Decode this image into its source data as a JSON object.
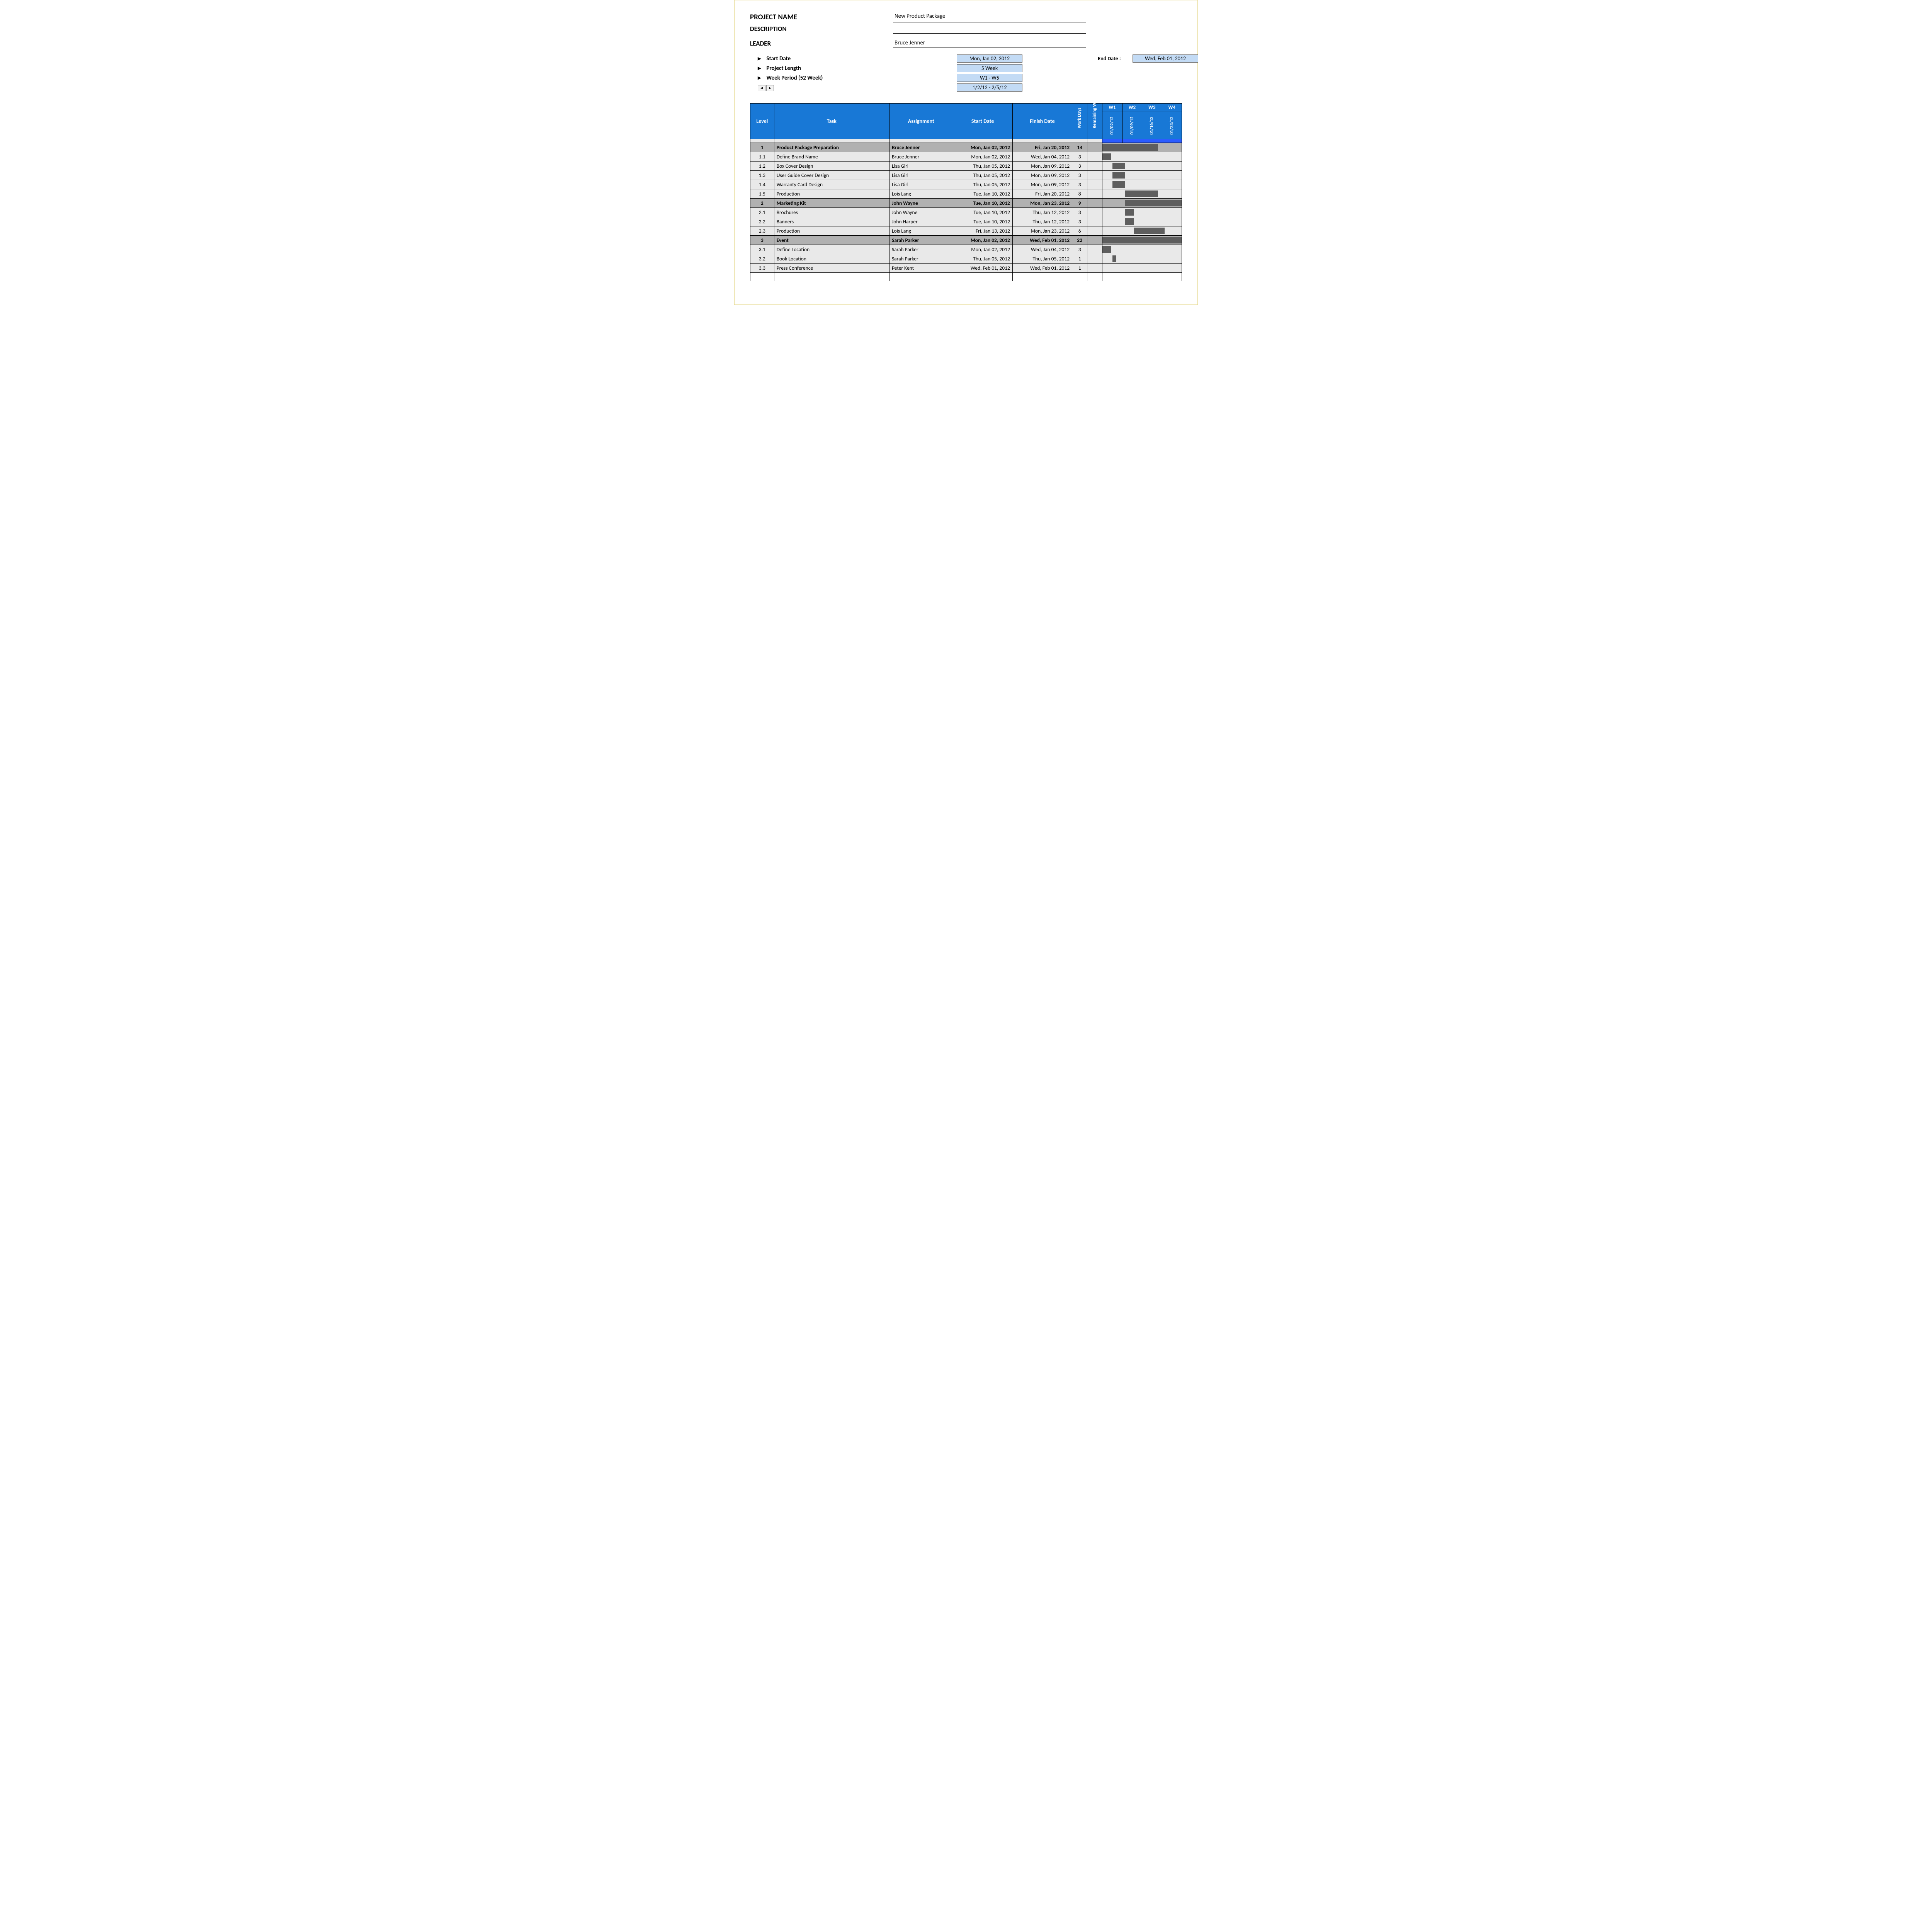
{
  "labels": {
    "projectName": "PROJECT NAME",
    "description": "DESCRIPTION",
    "leader": "LEADER",
    "startDate": "Start Date",
    "projectLength": "Project Length",
    "weekPeriod": "Week Period (52 Week)",
    "endDate": "End Date :"
  },
  "header": {
    "projectName": "New Product Package",
    "description": "",
    "leader": "Bruce Jenner",
    "startDate": "Mon, Jan 02, 2012",
    "endDate": "Wed, Feb 01, 2012",
    "projectLength": "5 Week",
    "weekPeriod": "W1 - W5",
    "dateRange": "1/2/12 - 2/5/12"
  },
  "columns": {
    "level": "Level",
    "task": "Task",
    "assignment": "Assignment",
    "startDate": "Start Date",
    "finishDate": "Finish Date",
    "workDays": "Work Days",
    "remaining": "Remaining WI"
  },
  "weeks": [
    {
      "label": "W1",
      "date": "01/02/12"
    },
    {
      "label": "W2",
      "date": "01/09/12"
    },
    {
      "label": "W3",
      "date": "01/16/12"
    },
    {
      "label": "W4",
      "date": "01/23/12"
    }
  ],
  "rows": [
    {
      "group": true,
      "level": "1",
      "task": "Product Package Preparation",
      "assign": "Bruce Jenner",
      "start": "Mon, Jan 02, 2012",
      "finish": "Fri, Jan 20, 2012",
      "wd": "14",
      "bar": [
        0,
        2.8
      ]
    },
    {
      "group": false,
      "level": "1.1",
      "task": "Define Brand Name",
      "assign": "Bruce Jenner",
      "start": "Mon, Jan 02, 2012",
      "finish": "Wed, Jan 04, 2012",
      "wd": "3",
      "bar": [
        0,
        0.45
      ]
    },
    {
      "group": false,
      "level": "1.2",
      "task": "Box Cover Design",
      "assign": "Lisa Girl",
      "start": "Thu, Jan 05, 2012",
      "finish": "Mon, Jan 09, 2012",
      "wd": "3",
      "bar": [
        0.5,
        1.15
      ]
    },
    {
      "group": false,
      "level": "1.3",
      "task": "User Guide Cover Design",
      "assign": "Lisa Girl",
      "start": "Thu, Jan 05, 2012",
      "finish": "Mon, Jan 09, 2012",
      "wd": "3",
      "bar": [
        0.5,
        1.15
      ]
    },
    {
      "group": false,
      "level": "1.4",
      "task": "Warranty Card Design",
      "assign": "Lisa Girl",
      "start": "Thu, Jan 05, 2012",
      "finish": "Mon, Jan 09, 2012",
      "wd": "3",
      "bar": [
        0.5,
        1.15
      ]
    },
    {
      "group": false,
      "level": "1.5",
      "task": "Production",
      "assign": "Lois Lang",
      "start": "Tue, Jan 10, 2012",
      "finish": "Fri, Jan 20, 2012",
      "wd": "8",
      "bar": [
        1.15,
        2.8
      ]
    },
    {
      "group": true,
      "level": "2",
      "task": "Marketing Kit",
      "assign": "John Wayne",
      "start": "Tue, Jan 10, 2012",
      "finish": "Mon, Jan 23, 2012",
      "wd": "9",
      "bar": [
        1.15,
        4
      ]
    },
    {
      "group": false,
      "level": "2.1",
      "task": "Brochures",
      "assign": "John Wayne",
      "start": "Tue, Jan 10, 2012",
      "finish": "Thu, Jan 12, 2012",
      "wd": "3",
      "bar": [
        1.15,
        1.6
      ]
    },
    {
      "group": false,
      "level": "2.2",
      "task": "Banners",
      "assign": "John Harper",
      "start": "Tue, Jan 10, 2012",
      "finish": "Thu, Jan 12, 2012",
      "wd": "3",
      "bar": [
        1.15,
        1.6
      ]
    },
    {
      "group": false,
      "level": "2.3",
      "task": "Production",
      "assign": "Lois Lang",
      "start": "Fri, Jan 13, 2012",
      "finish": "Mon, Jan 23, 2012",
      "wd": "6",
      "bar": [
        1.6,
        3.15
      ]
    },
    {
      "group": true,
      "level": "3",
      "task": "Event",
      "assign": "Sarah Parker",
      "start": "Mon, Jan 02, 2012",
      "finish": "Wed, Feb 01, 2012",
      "wd": "22",
      "bar": [
        0,
        4
      ]
    },
    {
      "group": false,
      "level": "3.1",
      "task": "Define Location",
      "assign": "Sarah Parker",
      "start": "Mon, Jan 02, 2012",
      "finish": "Wed, Jan 04, 2012",
      "wd": "3",
      "bar": [
        0,
        0.45
      ]
    },
    {
      "group": false,
      "level": "3.2",
      "task": "Book Location",
      "assign": "Sarah Parker",
      "start": "Thu, Jan 05, 2012",
      "finish": "Thu, Jan 05, 2012",
      "wd": "1",
      "bar": [
        0.5,
        0.7
      ]
    },
    {
      "group": false,
      "level": "3.3",
      "task": "Press Conference",
      "assign": "Peter Kent",
      "start": "Wed, Feb 01, 2012",
      "finish": "Wed, Feb 01, 2012",
      "wd": "1",
      "bar": null
    }
  ],
  "chart_data": {
    "type": "gantt",
    "unit": "week-index (0 = start of W1 01/02/12, 4 = end of W4 01/23/12)",
    "weeks": [
      "01/02/12",
      "01/09/12",
      "01/16/12",
      "01/23/12"
    ],
    "tasks": [
      {
        "level": "1",
        "name": "Product Package Preparation",
        "start": 0,
        "end": 2.8
      },
      {
        "level": "1.1",
        "name": "Define Brand Name",
        "start": 0,
        "end": 0.45
      },
      {
        "level": "1.2",
        "name": "Box Cover Design",
        "start": 0.5,
        "end": 1.15
      },
      {
        "level": "1.3",
        "name": "User Guide Cover Design",
        "start": 0.5,
        "end": 1.15
      },
      {
        "level": "1.4",
        "name": "Warranty Card Design",
        "start": 0.5,
        "end": 1.15
      },
      {
        "level": "1.5",
        "name": "Production",
        "start": 1.15,
        "end": 2.8
      },
      {
        "level": "2",
        "name": "Marketing Kit",
        "start": 1.15,
        "end": 4
      },
      {
        "level": "2.1",
        "name": "Brochures",
        "start": 1.15,
        "end": 1.6
      },
      {
        "level": "2.2",
        "name": "Banners",
        "start": 1.15,
        "end": 1.6
      },
      {
        "level": "2.3",
        "name": "Production",
        "start": 1.6,
        "end": 3.15
      },
      {
        "level": "3",
        "name": "Event",
        "start": 0,
        "end": 4
      },
      {
        "level": "3.1",
        "name": "Define Location",
        "start": 0,
        "end": 0.45
      },
      {
        "level": "3.2",
        "name": "Book Location",
        "start": 0.5,
        "end": 0.7
      },
      {
        "level": "3.3",
        "name": "Press Conference",
        "start": null,
        "end": null
      }
    ]
  }
}
